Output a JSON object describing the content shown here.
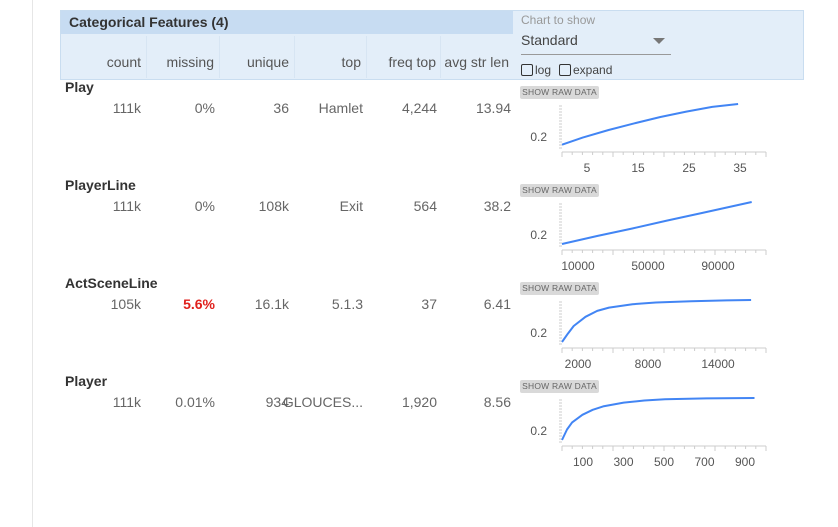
{
  "section": {
    "title": "Categorical Features (4)",
    "columns": [
      "count",
      "missing",
      "unique",
      "top",
      "freq top",
      "avg str len"
    ]
  },
  "controls": {
    "chart_label": "Chart to show",
    "chart_select_value": "Standard",
    "log_label": "log",
    "expand_label": "expand",
    "raw_button_label": "SHOW RAW DATA"
  },
  "features": [
    {
      "name": "Play",
      "count": "111k",
      "missing": "0%",
      "unique": "36",
      "top": "Hamlet",
      "freq_top": "4,244",
      "avg_str_len": "13.94"
    },
    {
      "name": "PlayerLine",
      "count": "111k",
      "missing": "0%",
      "unique": "108k",
      "top": "Exit",
      "freq_top": "564",
      "avg_str_len": "38.2"
    },
    {
      "name": "ActSceneLine",
      "count": "105k",
      "missing": "5.6%",
      "unique": "16.1k",
      "top": "5.1.3",
      "freq_top": "37",
      "avg_str_len": "6.41"
    },
    {
      "name": "Player",
      "count": "111k",
      "missing": "0.01%",
      "unique": "934",
      "top": "GLOUCES...",
      "freq_top": "1,920",
      "avg_str_len": "8.56"
    }
  ],
  "colors": {
    "line": "#4285f4",
    "warn": "#e0201c",
    "header_bg": "#e3eef9",
    "title_bg": "#c7dcf2"
  },
  "chart_data": [
    {
      "type": "line",
      "feature": "Play",
      "x": [
        1,
        5,
        10,
        15,
        20,
        25,
        30,
        35
      ],
      "y": [
        0.03,
        0.2,
        0.38,
        0.54,
        0.69,
        0.82,
        0.93,
        1.0
      ],
      "xlim": [
        1,
        40
      ],
      "ylim": [
        0,
        1
      ],
      "xticks": [
        "5",
        "15",
        "25",
        "35"
      ],
      "ytick": "0.2"
    },
    {
      "type": "line",
      "feature": "PlayerLine",
      "x": [
        1,
        20000,
        40000,
        60000,
        80000,
        108000
      ],
      "y": [
        0.0,
        0.19,
        0.37,
        0.56,
        0.74,
        1.0
      ],
      "xlim": [
        1,
        115000
      ],
      "ylim": [
        0,
        1
      ],
      "xticks": [
        "10000",
        "50000",
        "90000"
      ],
      "ytick": "0.2"
    },
    {
      "type": "line",
      "feature": "ActSceneLine",
      "x": [
        1,
        500,
        1000,
        2000,
        3000,
        4000,
        6000,
        8000,
        11000,
        14000,
        16100
      ],
      "y": [
        0.0,
        0.2,
        0.38,
        0.6,
        0.74,
        0.82,
        0.9,
        0.94,
        0.97,
        0.99,
        1.0
      ],
      "xlim": [
        1,
        17200
      ],
      "ylim": [
        0,
        1
      ],
      "xticks": [
        "2000",
        "8000",
        "14000"
      ],
      "ytick": "0.2"
    },
    {
      "type": "line",
      "feature": "Player",
      "x": [
        1,
        25,
        50,
        100,
        150,
        200,
        300,
        400,
        500,
        700,
        934
      ],
      "y": [
        0.0,
        0.25,
        0.42,
        0.6,
        0.72,
        0.8,
        0.89,
        0.94,
        0.97,
        0.99,
        1.0
      ],
      "xlim": [
        1,
        980
      ],
      "ylim": [
        0,
        1
      ],
      "xticks": [
        "100",
        "300",
        "500",
        "700",
        "900"
      ],
      "ytick": "0.2"
    }
  ]
}
